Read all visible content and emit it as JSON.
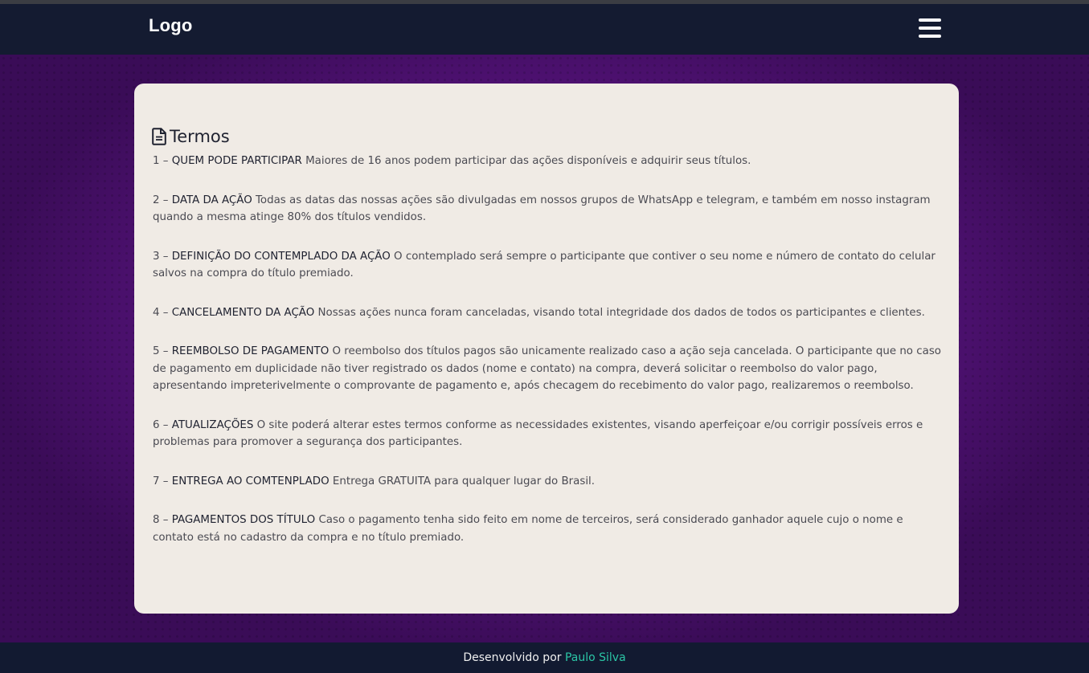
{
  "header": {
    "logo": "Logo",
    "menu_icon": "hamburger-menu-icon"
  },
  "page": {
    "title": "Termos",
    "title_icon": "file-text-icon"
  },
  "terms": [
    {
      "num": "1 –",
      "heading": "QUEM PODE PARTICIPAR",
      "text": "Maiores de 16 anos podem participar das ações disponíveis e adquirir seus títulos."
    },
    {
      "num": "2 –",
      "heading": "DATA DA AÇÃO",
      "text": "Todas as datas das nossas ações são divulgadas em nossos grupos de WhatsApp e telegram, e também em nosso instagram quando a mesma atinge 80% dos títulos vendidos."
    },
    {
      "num": "3 –",
      "heading": "DEFINIÇÃO DO CONTEMPLADO DA AÇÃO",
      "text": "O contemplado será sempre o participante que contiver o seu nome e número de contato do celular salvos na compra do título premiado."
    },
    {
      "num": "4 –",
      "heading": "CANCELAMENTO DA AÇÃO",
      "text": "Nossas ações nunca foram canceladas, visando total integridade dos dados de todos os participantes e clientes."
    },
    {
      "num": "5 –",
      "heading": "REEMBOLSO DE PAGAMENTO",
      "text": "O reembolso dos títulos pagos são unicamente realizado caso a ação seja cancelada. O participante que no caso de pagamento em duplicidade não tiver registrado os dados (nome e contato) na compra, deverá solicitar o reembolso do valor pago, apresentando impreterivelmente o comprovante de pagamento e, após checagem do recebimento do valor pago, realizaremos o reembolso."
    },
    {
      "num": "6 –",
      "heading": "ATUALIZAÇÕES",
      "text": "O site poderá alterar estes termos conforme as necessidades existentes, visando aperfeiçoar e/ou corrigir possíveis erros e problemas para promover a segurança dos participantes."
    },
    {
      "num": "7 –",
      "heading": "ENTREGA AO COMTENPLADO",
      "text": "Entrega GRATUITA para qualquer lugar do Brasil."
    },
    {
      "num": "8 –",
      "heading": "PAGAMENTOS DOS TÍTULO",
      "text": "Caso o pagamento tenha sido feito em nome de terceiros, será considerado ganhador aquele cujo o nome e contato está no cadastro da compra e no título premiado."
    }
  ],
  "footer": {
    "prefix": "Desenvolvido por",
    "author": "Paulo Silva"
  },
  "colors": {
    "navbar": "#141b31",
    "background_purple": "#5c1585",
    "card": "#f0ebe5",
    "footer_link": "#2bc6a6"
  }
}
